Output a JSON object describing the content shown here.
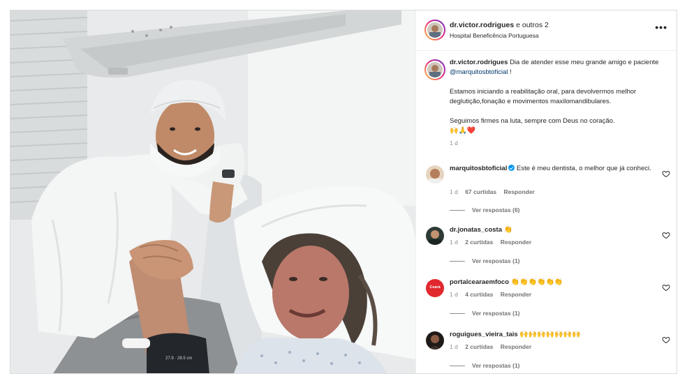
{
  "post": {
    "header": {
      "username": "dr.victor.rodrigues",
      "coauthors": "e outros 2",
      "location": "Hospital Beneficência Portuguesa",
      "more_label": "•••"
    },
    "caption": {
      "username": "dr.victor.rodrigues",
      "text_1": "Dia de atender esse meu grande amigo e paciente",
      "mention": "@marquitosbtoficial",
      "text_1_end": " !",
      "text_2": "Estamos iniciando a reabilitação oral, para devolvermos melhor deglutição,fonação e movimentos maxilomandibulares.",
      "text_3": "Seguimos firmes na luta, sempre com Deus no coração.",
      "emojis": "🙌🙏❤️",
      "time": "1 d"
    },
    "comments": [
      {
        "username": "marquitosbtoficial",
        "verified": true,
        "text": "Este é meu dentista, o melhor que já conheci.",
        "time": "1 d",
        "likes": "67 curtidas",
        "reply": "Responder",
        "view_replies": "Ver respostas (6)"
      },
      {
        "username": "dr.jonatas_costa",
        "verified": false,
        "text": "👏",
        "time": "1 d",
        "likes": "2 curtidas",
        "reply": "Responder",
        "view_replies": "Ver respostas (1)"
      },
      {
        "username": "portalcearaemfoco",
        "verified": false,
        "text": "👏👏👏👏👏👏",
        "time": "1 d",
        "likes": "4 curtidas",
        "reply": "Responder",
        "view_replies": "Ver respostas (1)",
        "avatar_text": "Ceará"
      },
      {
        "username": "roguigues_vieira_tais",
        "verified": false,
        "text": "🙌🙌🙌🙌🙌🙌🙌",
        "time": "1 d",
        "likes": "2 curtidas",
        "reply": "Responder",
        "view_replies": "Ver respostas (1)"
      }
    ]
  },
  "photo": {
    "watch_readout": "27.9 · 28.5 cm"
  },
  "icons": {
    "heart": "heart-outline-icon",
    "more": "more-horizontal-icon",
    "verified": "verified-badge-icon"
  },
  "colors": {
    "text": "#262626",
    "muted": "#8e8e8e",
    "mention": "#00376b",
    "verified": "#0095f6",
    "border": "#dbdbdb"
  }
}
